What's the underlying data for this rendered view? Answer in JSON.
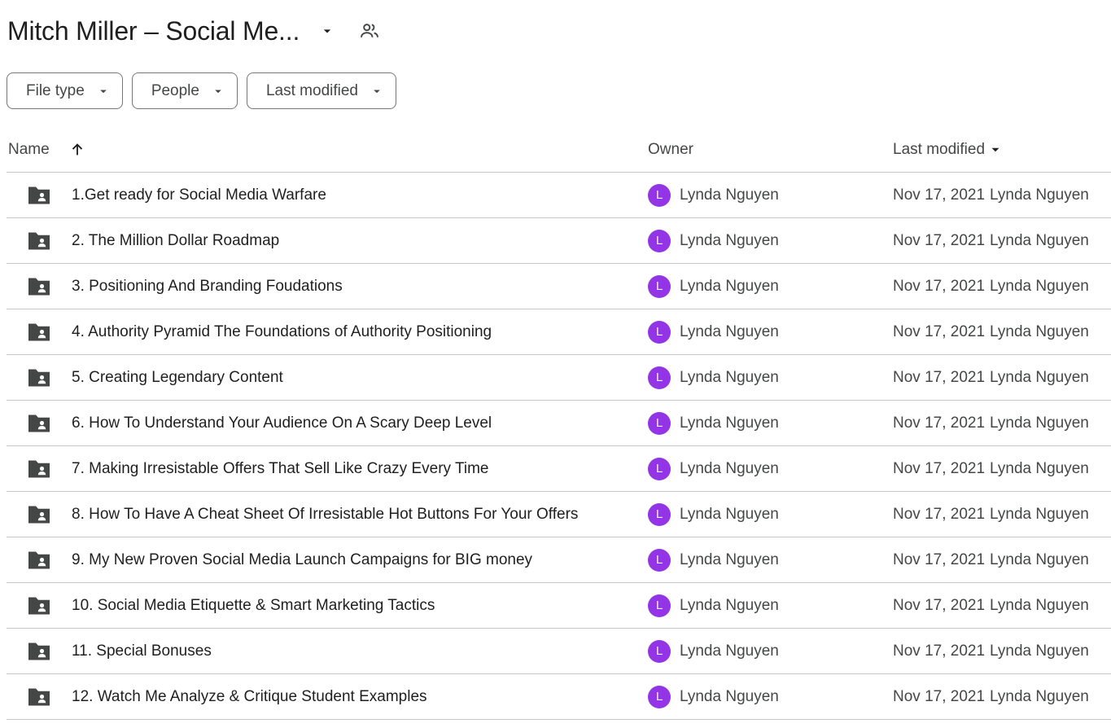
{
  "header": {
    "title": "Mitch Miller – Social Me...",
    "title_caret_icon": "arrow-drop-down-icon",
    "shared_icon": "people-icon"
  },
  "filters": [
    {
      "label": "File type"
    },
    {
      "label": "People"
    },
    {
      "label": "Last modified"
    }
  ],
  "table": {
    "columns": {
      "name": "Name",
      "owner": "Owner",
      "last_modified": "Last modified"
    },
    "sort": {
      "column": "name",
      "direction": "ascending"
    },
    "rows": [
      {
        "name": "1.Get ready for Social Media Warfare",
        "owner": "Lynda Nguyen",
        "owner_initial": "L",
        "modified_date": "Nov 17, 2021",
        "modified_by": "Lynda Nguyen"
      },
      {
        "name": "2. The Million Dollar Roadmap",
        "owner": "Lynda Nguyen",
        "owner_initial": "L",
        "modified_date": "Nov 17, 2021",
        "modified_by": "Lynda Nguyen"
      },
      {
        "name": "3. Positioning And Branding Foudations",
        "owner": "Lynda Nguyen",
        "owner_initial": "L",
        "modified_date": "Nov 17, 2021",
        "modified_by": "Lynda Nguyen"
      },
      {
        "name": "4. Authority Pyramid The Foundations of Authority Positioning",
        "owner": "Lynda Nguyen",
        "owner_initial": "L",
        "modified_date": "Nov 17, 2021",
        "modified_by": "Lynda Nguyen"
      },
      {
        "name": "5. Creating Legendary Content",
        "owner": "Lynda Nguyen",
        "owner_initial": "L",
        "modified_date": "Nov 17, 2021",
        "modified_by": "Lynda Nguyen"
      },
      {
        "name": "6. How To Understand Your Audience On A Scary Deep Level",
        "owner": "Lynda Nguyen",
        "owner_initial": "L",
        "modified_date": "Nov 17, 2021",
        "modified_by": "Lynda Nguyen"
      },
      {
        "name": "7. Making Irresistable Offers That Sell Like Crazy Every Time",
        "owner": "Lynda Nguyen",
        "owner_initial": "L",
        "modified_date": "Nov 17, 2021",
        "modified_by": "Lynda Nguyen"
      },
      {
        "name": "8. How To Have A Cheat Sheet Of Irresistable Hot Buttons For Your Offers",
        "owner": "Lynda Nguyen",
        "owner_initial": "L",
        "modified_date": "Nov 17, 2021",
        "modified_by": "Lynda Nguyen"
      },
      {
        "name": "9. My New Proven Social Media Launch Campaigns for BIG money",
        "owner": "Lynda Nguyen",
        "owner_initial": "L",
        "modified_date": "Nov 17, 2021",
        "modified_by": "Lynda Nguyen"
      },
      {
        "name": "10. Social Media Etiquette & Smart Marketing Tactics",
        "owner": "Lynda Nguyen",
        "owner_initial": "L",
        "modified_date": "Nov 17, 2021",
        "modified_by": "Lynda Nguyen"
      },
      {
        "name": "11. Special Bonuses",
        "owner": "Lynda Nguyen",
        "owner_initial": "L",
        "modified_date": "Nov 17, 2021",
        "modified_by": "Lynda Nguyen"
      },
      {
        "name": "12. Watch Me Analyze & Critique Student Examples",
        "owner": "Lynda Nguyen",
        "owner_initial": "L",
        "modified_date": "Nov 17, 2021",
        "modified_by": "Lynda Nguyen"
      }
    ]
  },
  "colors": {
    "avatar": "#9334e6",
    "folder_icon": "#444746",
    "divider": "#c7c7c7",
    "chip_border": "#747775"
  }
}
